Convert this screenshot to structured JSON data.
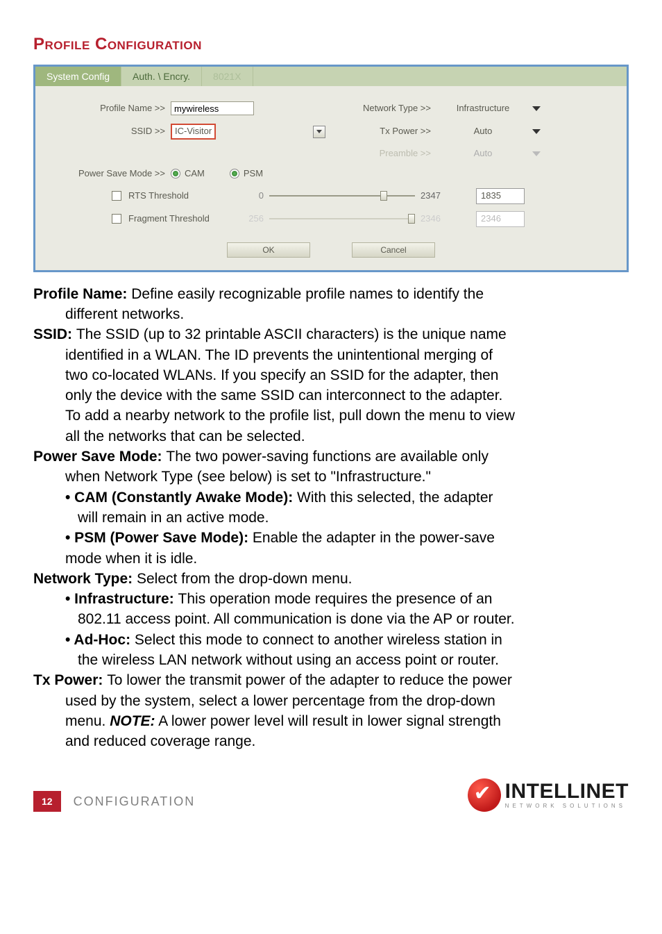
{
  "title": "Profile Configuration",
  "panel": {
    "tabs": {
      "t0": "System Config",
      "t1": "Auth. \\ Encry.",
      "t2": "8021X"
    },
    "labels": {
      "profileName": "Profile Name >>",
      "ssid": "SSID >>",
      "psm": "Power Save Mode >>",
      "camOpt": "CAM",
      "psmOpt": "PSM",
      "netType": "Network Type >>",
      "txPower": "Tx Power >>",
      "preamble": "Preamble >>",
      "rts": "RTS Threshold",
      "frag": "Fragment Threshold",
      "ok": "OK",
      "cancel": "Cancel"
    },
    "values": {
      "profileName": "mywireless",
      "ssid": "IC-Visitor",
      "netType": "Infrastructure",
      "txPower": "Auto",
      "preamble": "Auto",
      "rtsMin": "0",
      "rtsMax": "2347",
      "rtsVal": "1835",
      "fragMin": "256",
      "fragMax": "2346",
      "fragVal": "2346"
    }
  },
  "desc": {
    "profileName": {
      "term": "Profile Name: ",
      "body1": "Define easily recognizable profile names to identify the",
      "body2": "different networks."
    },
    "ssid": {
      "term": "SSID: ",
      "l1": "The SSID (up to 32 printable ASCII characters) is the unique name",
      "l2": "identified in a WLAN. The ID prevents the unintentional merging of",
      "l3": "two co-located WLANs. If you specify an SSID for the adapter, then",
      "l4": "only the device with the same SSID can interconnect to the adapter.",
      "l5": "To add a nearby network to the profile list, pull down the menu to view",
      "l6": "all the networks that can be selected."
    },
    "psm": {
      "term": "Power Save Mode: ",
      "l1": "The two power-saving functions are available only",
      "l2": "when Network Type (see below) is set to \"Infrastructure.\"",
      "cam_t": "• CAM (Constantly Awake Mode): ",
      "cam_b1": "With this selected, the adapter",
      "cam_b2": "will remain in an active mode.",
      "psm_t": "• PSM (Power Save Mode): ",
      "psm_b1": "Enable the adapter in the power-save",
      "psm_b2": "mode when it is idle."
    },
    "nt": {
      "term": "Network Type: ",
      "l1": "Select from the drop-down menu.",
      "inf_t": "• Infrastructure: ",
      "inf_b1": "This operation mode requires the presence of an",
      "inf_b2": "802.11 access point. All communication is done via the AP or router.",
      "adh_t": "• Ad-Hoc: ",
      "adh_b1": "Select this mode to connect to another wireless station in",
      "adh_b2": "the wireless LAN network without using an access point or router."
    },
    "tx": {
      "term": "Tx Power: ",
      "l1": "To lower the transmit power of the adapter to reduce the power",
      "l2": "used by the system, select a lower percentage from the drop-down",
      "l3a": "menu. ",
      "note": "NOTE:",
      "l3b": " A lower power level will result in lower signal strength",
      "l4": "and reduced coverage range."
    }
  },
  "footer": {
    "page": "12",
    "section": "CONFIGURATION",
    "logo": "INTELLINET",
    "tag": "NETWORK SOLUTIONS"
  }
}
